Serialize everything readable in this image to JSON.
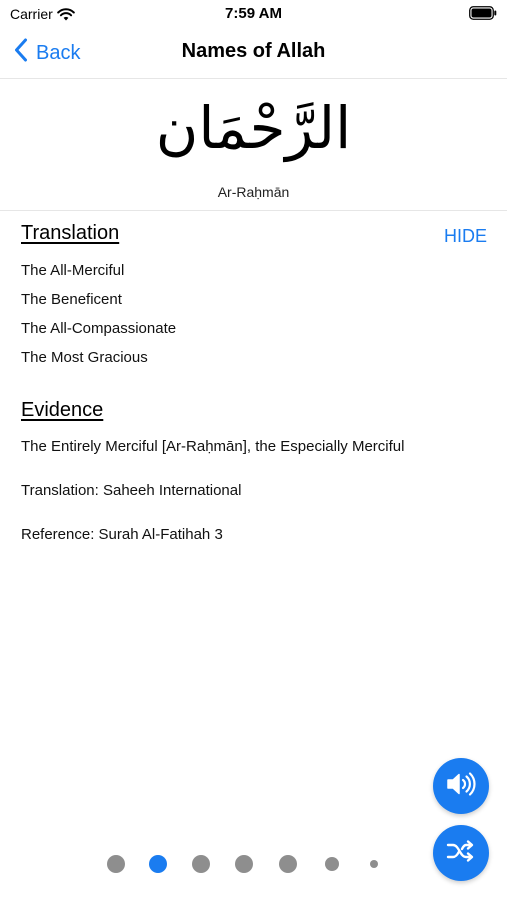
{
  "status_bar": {
    "carrier": "Carrier",
    "time": "7:59 AM"
  },
  "nav": {
    "back_label": "Back",
    "title": "Names of Allah"
  },
  "name": {
    "arabic": "الرَّحْمَان",
    "transliteration": "Ar-Raḥmān"
  },
  "translation": {
    "title": "Translation",
    "hide_label": "HIDE",
    "items": [
      "The All-Merciful",
      "The Beneficent",
      "The All-Compassionate",
      "The Most Gracious"
    ]
  },
  "evidence": {
    "title": "Evidence",
    "text": "The Entirely Merciful [Ar-Raḥmān], the Especially Merciful",
    "translation": "Translation: Saheeh International",
    "reference": "Reference: Surah Al-Fatihah 3"
  },
  "page_indicator": {
    "count": 7,
    "active_index": 1
  },
  "colors": {
    "accent": "#1a7cf0",
    "dot_inactive": "#8e8e8e"
  },
  "icons": {
    "back": "chevron-left-icon",
    "audio": "speaker-icon",
    "shuffle": "shuffle-icon"
  }
}
